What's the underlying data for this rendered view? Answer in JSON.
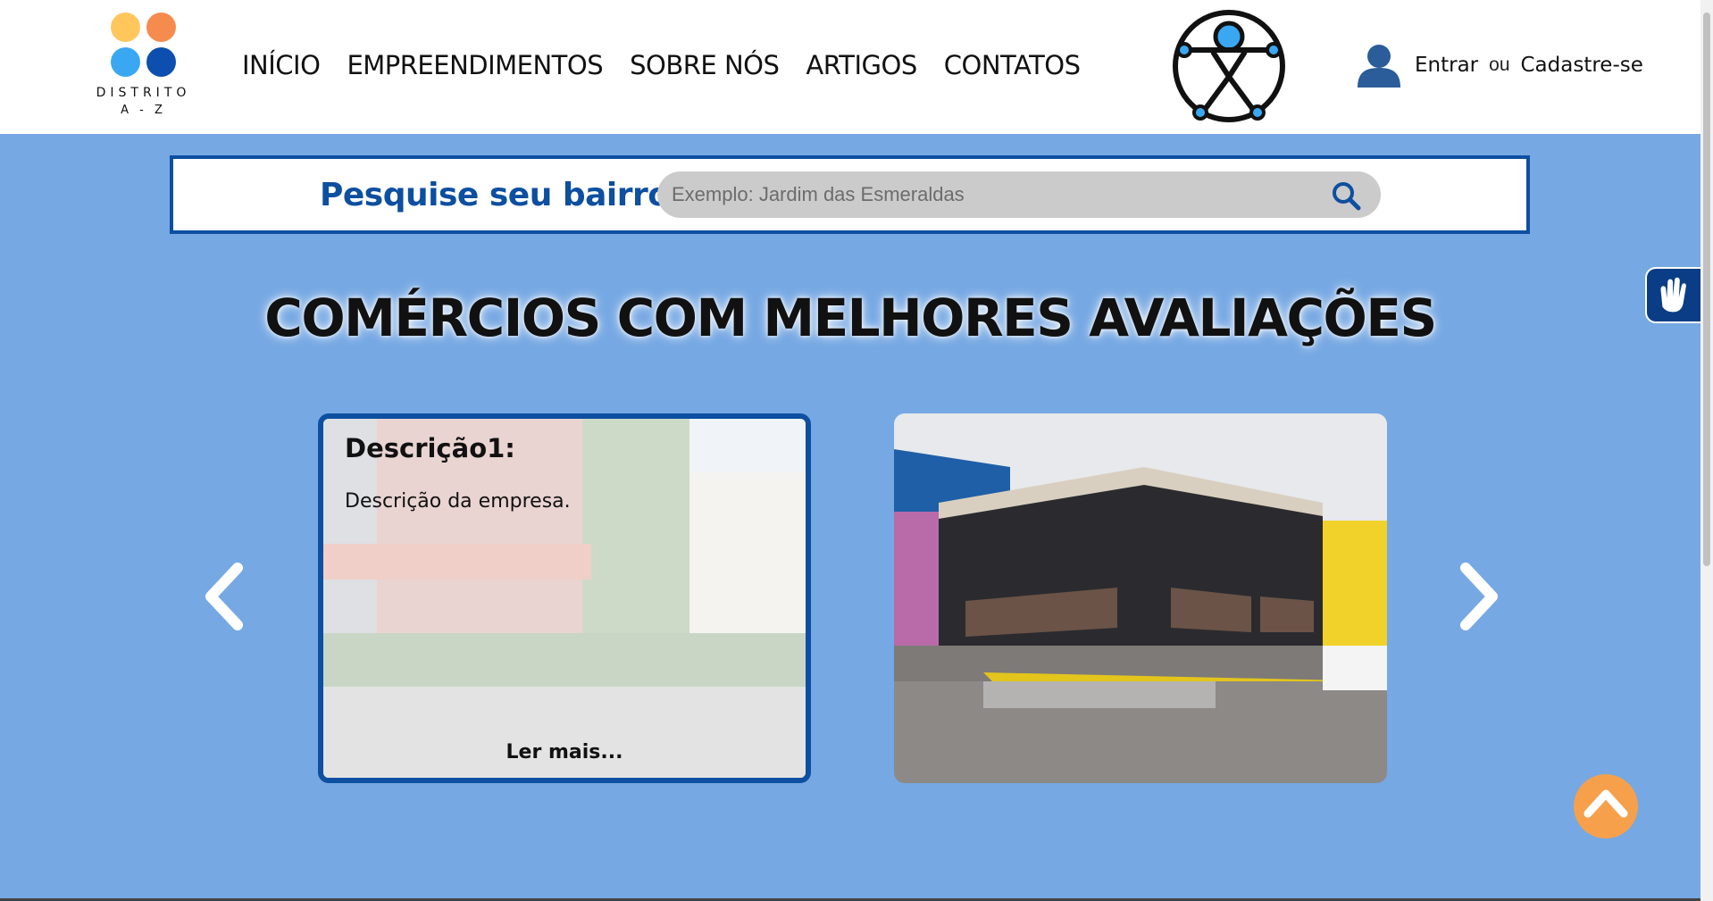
{
  "logo": {
    "line1": "DISTRITO",
    "line2": "A - Z"
  },
  "nav": {
    "items": [
      {
        "label": "INÍCIO"
      },
      {
        "label": "EMPREENDIMENTOS"
      },
      {
        "label": "SOBRE NÓS"
      },
      {
        "label": "ARTIGOS"
      },
      {
        "label": "CONTATOS"
      }
    ]
  },
  "auth": {
    "login": "Entrar",
    "or": "ou",
    "signup": "Cadastre-se"
  },
  "search": {
    "label": "Pesquise seu bairro:",
    "placeholder": "Exemplo: Jardim das Esmeraldas",
    "icon": "search-icon"
  },
  "heading": "COMÉRCIOS COM MELHORES AVALIAÇÕES",
  "carousel": {
    "prev_icon": "chevron-left-icon",
    "next_icon": "chevron-right-icon",
    "cards": [
      {
        "title": "Descrição1:",
        "text": "Descrição da empresa.",
        "more": "Ler mais..."
      },
      {
        "image": "storefront-photo"
      }
    ]
  },
  "widgets": {
    "libras_icon": "sign-language-hand-icon",
    "back_to_top_icon": "chevron-up-icon"
  },
  "colors": {
    "page_bg": "#76a8e3",
    "brand_blue": "#0d4fa0",
    "accent_orange": "#f7a04b"
  }
}
